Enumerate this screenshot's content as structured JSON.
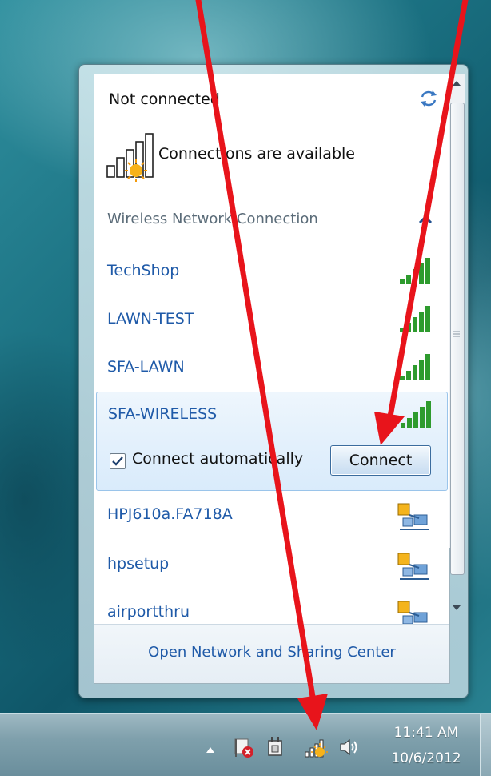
{
  "popup": {
    "status": "Not connected",
    "availability": "Connections are available",
    "section_title": "Wireless Network Connection",
    "networks": [
      {
        "name": "TechShop",
        "security": "secured"
      },
      {
        "name": "LAWN-TEST",
        "security": "secured"
      },
      {
        "name": "SFA-LAWN",
        "security": "secured"
      },
      {
        "name": "SFA-WIRELESS",
        "security": "secured",
        "selected": true
      },
      {
        "name": "HPJ610a.FA718A",
        "security": "adhoc"
      },
      {
        "name": "hpsetup",
        "security": "adhoc"
      },
      {
        "name": "airportthru",
        "security": "adhoc"
      }
    ],
    "connect_automatically_label": "Connect automatically",
    "connect_automatically_checked": true,
    "connect_button_label": "Connect",
    "footer_link": "Open Network and Sharing Center"
  },
  "taskbar": {
    "time": "11:41 AM",
    "date": "10/6/2012"
  },
  "colors": {
    "link": "#1f5aa8",
    "annotation_arrow": "#e8141b",
    "signal_green": "#2e9b2e"
  }
}
